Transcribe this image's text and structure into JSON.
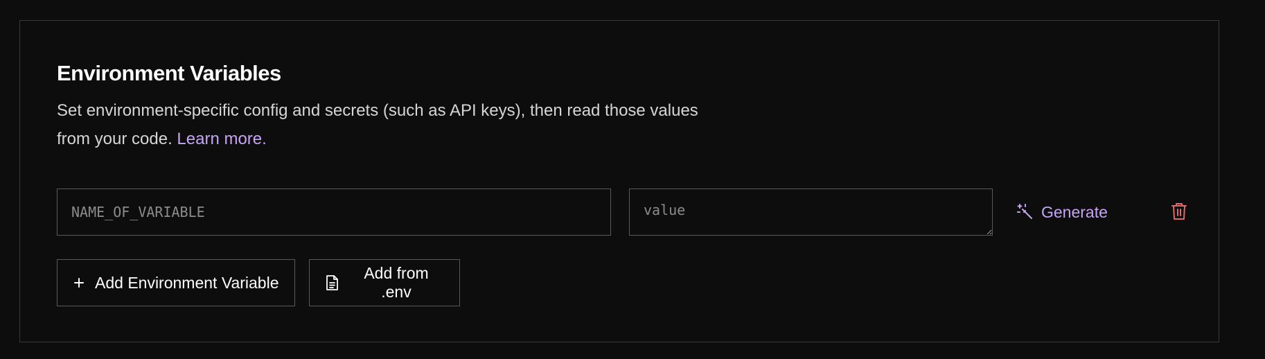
{
  "section": {
    "title": "Environment Variables",
    "description": "Set environment-specific config and secrets (such as API keys), then read those values from your code.",
    "learn_more_label": "Learn more."
  },
  "variable_row": {
    "name_placeholder": "NAME_OF_VARIABLE",
    "name_value": "",
    "value_placeholder": "value",
    "value_value": "",
    "generate_label": "Generate",
    "generate_icon": "magic-wand-icon",
    "delete_icon": "trash-icon"
  },
  "actions": {
    "add_variable_label": "Add Environment Variable",
    "add_variable_icon": "plus-icon",
    "add_from_env_label": "Add from .env",
    "add_from_env_icon": "document-icon"
  },
  "colors": {
    "background": "#0d0d0d",
    "border": "#3a3a3a",
    "accent": "#c7a4f5",
    "danger": "#e0696b",
    "text": "#ffffff",
    "muted_text": "#d6d6d6"
  }
}
